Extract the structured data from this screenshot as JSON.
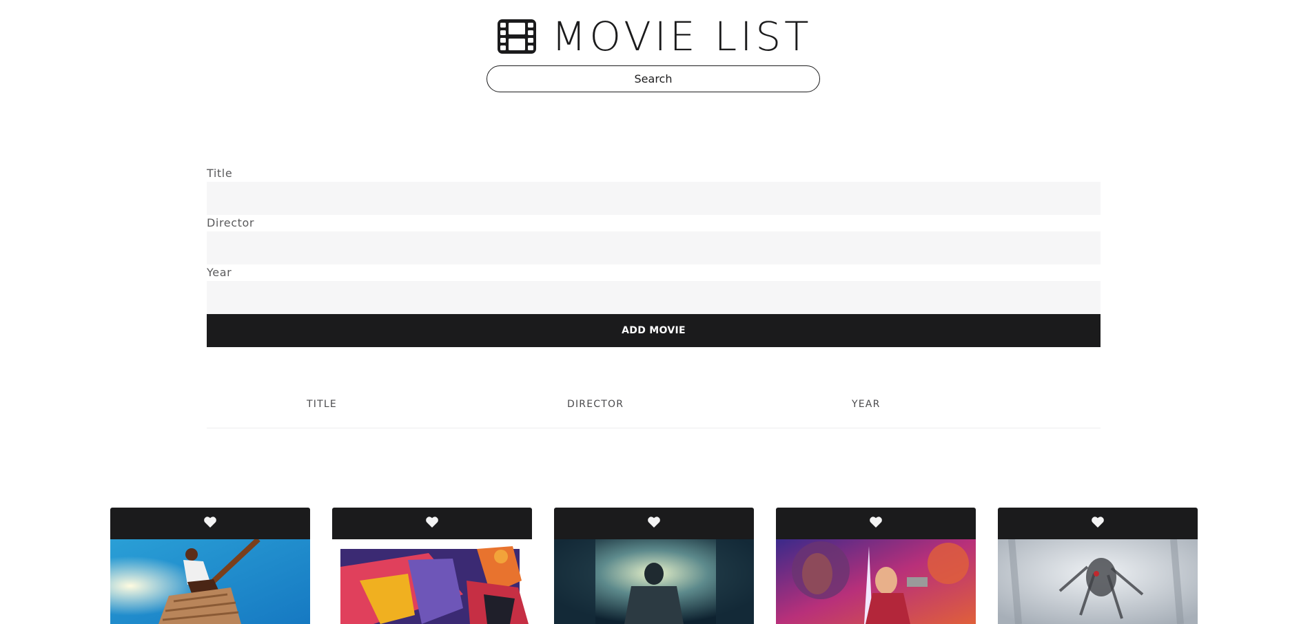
{
  "header": {
    "title": "MOVIE LIST",
    "logo_icon": "film-icon"
  },
  "search": {
    "placeholder": "Search"
  },
  "form": {
    "title_label": "Title",
    "director_label": "Director",
    "year_label": "Year",
    "submit_label": "ADD MOVIE"
  },
  "table": {
    "headers": [
      "TITLE",
      "DIRECTOR",
      "YEAR"
    ]
  },
  "cards": [
    {
      "icon": "heart-icon"
    },
    {
      "icon": "heart-icon"
    },
    {
      "icon": "heart-icon"
    },
    {
      "icon": "heart-icon"
    },
    {
      "icon": "heart-icon"
    }
  ],
  "colors": {
    "primary": "#1b1b1c",
    "input_bg": "#f6f6f7",
    "label": "#5a5a5c"
  }
}
